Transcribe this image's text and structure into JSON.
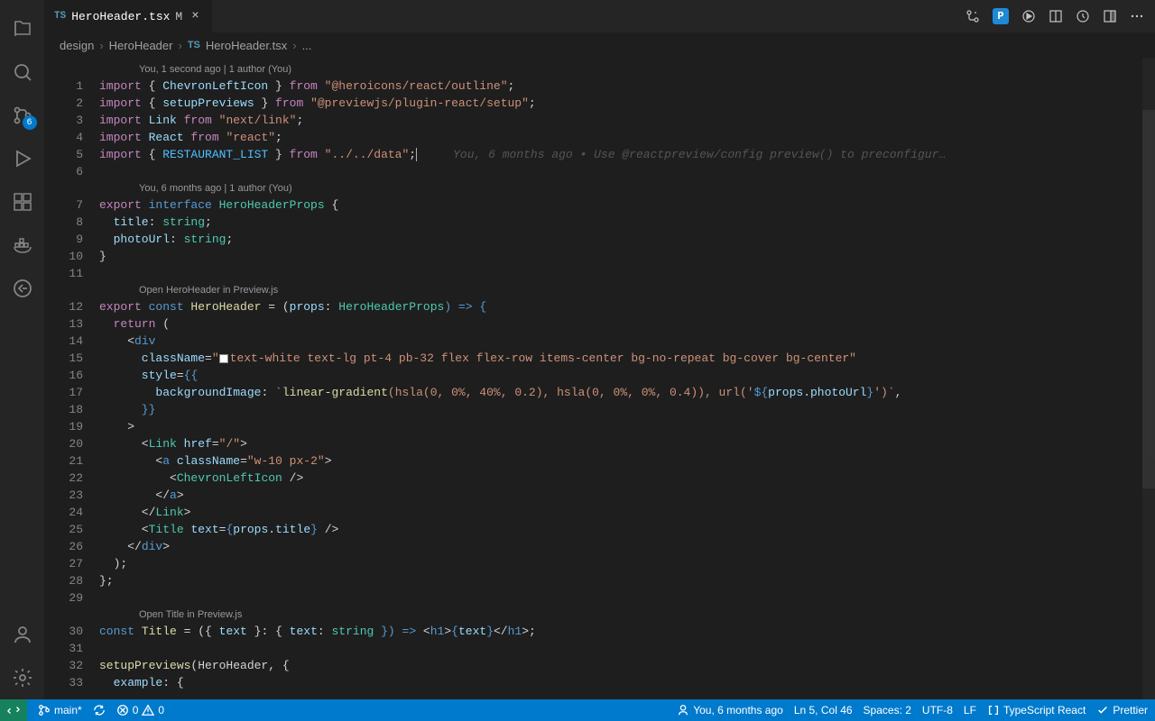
{
  "tab": {
    "ts_label": "TS",
    "filename": "HeroHeader.tsx",
    "modified": "M"
  },
  "tab_actions": {
    "p_label": "P"
  },
  "activity": {
    "scm_badge": "6"
  },
  "breadcrumbs": {
    "seg1": "design",
    "seg2": "HeroHeader",
    "ts_label": "TS",
    "seg3": "HeroHeader.tsx",
    "seg4": "..."
  },
  "codelens": {
    "l1": "You, 1 second ago | 1 author (You)",
    "l7": "You, 6 months ago | 1 author (You)",
    "l12": "Open HeroHeader in Preview.js",
    "l30": "Open Title in Preview.js"
  },
  "blame": {
    "l5": "You, 6 months ago • Use @reactpreview/config preview() to preconfigur…"
  },
  "lines": {
    "n1": "1",
    "n2": "2",
    "n3": "3",
    "n4": "4",
    "n5": "5",
    "n6": "6",
    "n7": "7",
    "n8": "8",
    "n9": "9",
    "n10": "10",
    "n11": "11",
    "n12": "12",
    "n13": "13",
    "n14": "14",
    "n15": "15",
    "n16": "16",
    "n17": "17",
    "n18": "18",
    "n19": "19",
    "n20": "20",
    "n21": "21",
    "n22": "22",
    "n23": "23",
    "n24": "24",
    "n25": "25",
    "n26": "26",
    "n27": "27",
    "n28": "28",
    "n29": "29",
    "n30": "30",
    "n31": "31",
    "n32": "32",
    "n33": "33"
  },
  "code": {
    "l1_import": "import",
    "l1_brace_o": " { ",
    "l1_id": "ChevronLeftIcon",
    "l1_brace_c": " } ",
    "l1_from": "from ",
    "l1_str": "\"@heroicons/react/outline\"",
    "l1_semi": ";",
    "l2_import": "import",
    "l2_brace_o": " { ",
    "l2_id": "setupPreviews",
    "l2_brace_c": " } ",
    "l2_from": "from ",
    "l2_str": "\"@previewjs/plugin-react/setup\"",
    "l2_semi": ";",
    "l3_import": "import",
    "l3_id": " Link ",
    "l3_from": "from ",
    "l3_str": "\"next/link\"",
    "l3_semi": ";",
    "l4_import": "import",
    "l4_id": " React ",
    "l4_from": "from ",
    "l4_str": "\"react\"",
    "l4_semi": ";",
    "l5_import": "import",
    "l5_brace_o": " { ",
    "l5_id": "RESTAURANT_LIST",
    "l5_brace_c": " } ",
    "l5_from": "from ",
    "l5_str": "\"../../data\"",
    "l5_semi": ";",
    "l7_export": "export ",
    "l7_interface": "interface ",
    "l7_name": "HeroHeaderProps",
    "l7_brace": " {",
    "l8_field": "  title",
    "l8_colon": ": ",
    "l8_type": "string",
    "l8_semi": ";",
    "l9_field": "  photoUrl",
    "l9_colon": ": ",
    "l9_type": "string",
    "l9_semi": ";",
    "l10": "}",
    "l12_export": "export ",
    "l12_const": "const ",
    "l12_name": "HeroHeader",
    "l12_eq": " = (",
    "l12_props": "props",
    "l12_colon": ": ",
    "l12_type": "HeroHeaderProps",
    "l12_arrow": ") => {",
    "l13_return": "  return ",
    "l13_paren": "(",
    "l14_open": "    <",
    "l14_tag": "div",
    "l15_attr": "      className",
    "l15_eq": "=",
    "l15_q": "\"",
    "l15_val": "text-white text-lg pt-4 pb-32 flex flex-row items-center bg-no-repeat bg-cover bg-center",
    "l15_q2": "\"",
    "l16_attr": "      style",
    "l16_eq": "=",
    "l16_brace": "{{",
    "l17_field": "        backgroundImage",
    "l17_colon": ": ",
    "l17_tick": "`",
    "l17_fn": "linear-gradient",
    "l17_args": "(hsla(0, 0%, 40%, 0.2), hsla(0, 0%, 0%, 0.4)), url('",
    "l17_interp": "${",
    "l17_props": "props",
    "l17_dot": ".",
    "l17_photo": "photoUrl",
    "l17_interp2": "}",
    "l17_end": "')`",
    "l17_comma": ",",
    "l18": "      }}",
    "l19": "    >",
    "l20_open": "      <",
    "l20_tag": "Link",
    "l20_sp": " ",
    "l20_attr": "href",
    "l20_eq": "=",
    "l20_val": "\"/\"",
    "l20_close": ">",
    "l21_open": "        <",
    "l21_tag": "a",
    "l21_sp": " ",
    "l21_attr": "className",
    "l21_eq": "=",
    "l21_val": "\"w-10 px-2\"",
    "l21_close": ">",
    "l22_open": "          <",
    "l22_tag": "ChevronLeftIcon",
    "l22_close": " />",
    "l23_open": "        </",
    "l23_tag": "a",
    "l23_close": ">",
    "l24_open": "      </",
    "l24_tag": "Link",
    "l24_close": ">",
    "l25_open": "      <",
    "l25_tag": "Title",
    "l25_sp": " ",
    "l25_attr": "text",
    "l25_eq": "=",
    "l25_brace": "{",
    "l25_props": "props",
    "l25_dot": ".",
    "l25_title": "title",
    "l25_brace2": "}",
    "l25_close": " />",
    "l26_open": "    </",
    "l26_tag": "div",
    "l26_close": ">",
    "l27": "  );",
    "l28": "};",
    "l30_const": "const ",
    "l30_name": "Title",
    "l30_eq": " = ({ ",
    "l30_text": "text",
    "l30_mid": " }: { ",
    "l30_text2": "text",
    "l30_colon": ": ",
    "l30_type": "string",
    "l30_arrow": " }) => ",
    "l30_open": "<",
    "l30_tag": "h1",
    "l30_gt": ">",
    "l30_brace": "{",
    "l30_var": "text",
    "l30_brace2": "}",
    "l30_close": "</",
    "l30_tag2": "h1",
    "l30_gt2": ">;",
    "l32_fn": "setupPreviews",
    "l32_args": "(HeroHeader, {",
    "l33_field": "  example",
    "l33_rest": ": {"
  },
  "status": {
    "branch": "main*",
    "errors": "0",
    "warnings": "0",
    "blame": "You, 6 months ago",
    "lncol": "Ln 5, Col 46",
    "spaces": "Spaces: 2",
    "encoding": "UTF-8",
    "eol": "LF",
    "lang": "TypeScript React",
    "prettier": "Prettier"
  }
}
